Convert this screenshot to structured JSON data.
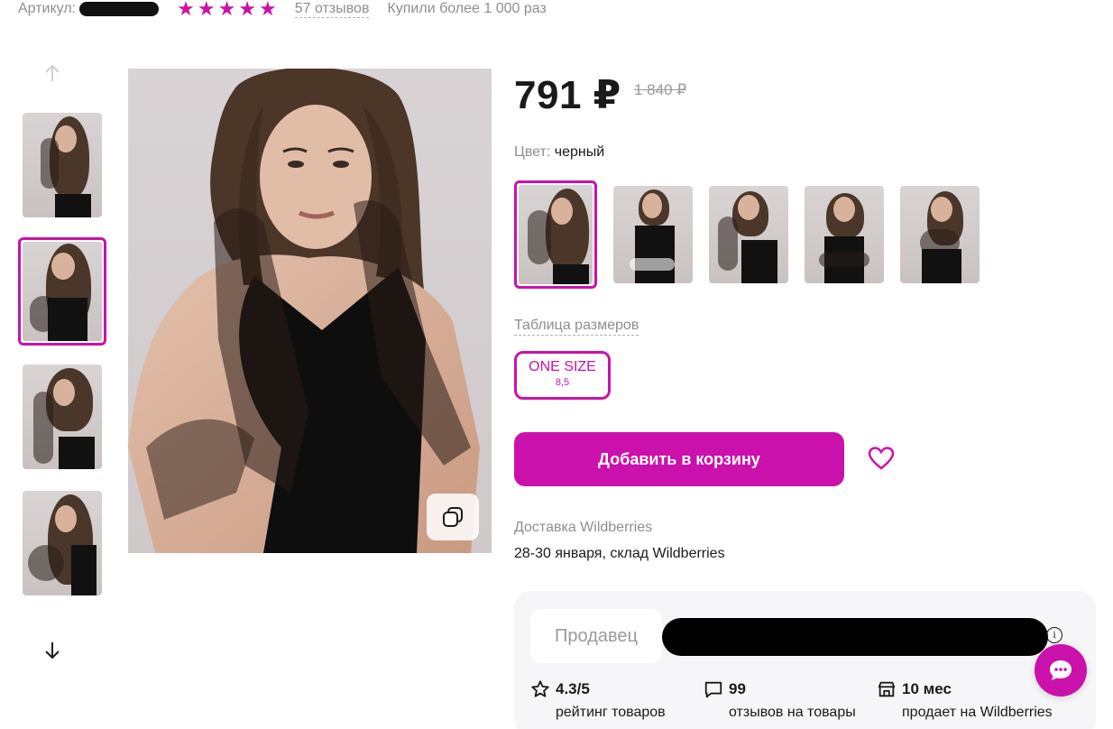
{
  "header": {
    "sku_label": "Артикул:",
    "rating_stars": 5,
    "reviews_link": "57 отзывов",
    "bought_text": "Купили более 1 000 раз"
  },
  "gallery": {
    "thumbnail_count": 4,
    "selected_index": 1,
    "nav_up_icon": "arrow-up-icon",
    "nav_down_icon": "arrow-down-icon",
    "copy_icon": "copy-icon"
  },
  "product": {
    "price": "791 ₽",
    "old_price": "1 840 ₽",
    "color_label": "Цвет:",
    "color_value": "черный",
    "color_variants_count": 5,
    "size_table_link": "Таблица размеров",
    "size": {
      "label": "ONE SIZE",
      "sub": "8,5"
    },
    "add_to_cart": "Добавить в корзину",
    "favorite_icon": "heart-icon"
  },
  "delivery": {
    "title": "Доставка Wildberries",
    "date": "28-30 января, склад Wildberries"
  },
  "seller": {
    "label": "Продавец",
    "info_icon_text": "i",
    "stats": [
      {
        "icon": "star-icon",
        "value": "4.3/5",
        "caption": "рейтинг товаров"
      },
      {
        "icon": "comment-icon",
        "value": "99",
        "caption": "отзывов на товары"
      },
      {
        "icon": "store-icon",
        "value": "10 мес",
        "caption": "продает на Wildberries"
      }
    ]
  },
  "colors": {
    "accent": "#cb11ab",
    "muted_text": "#8e8e93",
    "card_bg": "#f6f6f9"
  }
}
